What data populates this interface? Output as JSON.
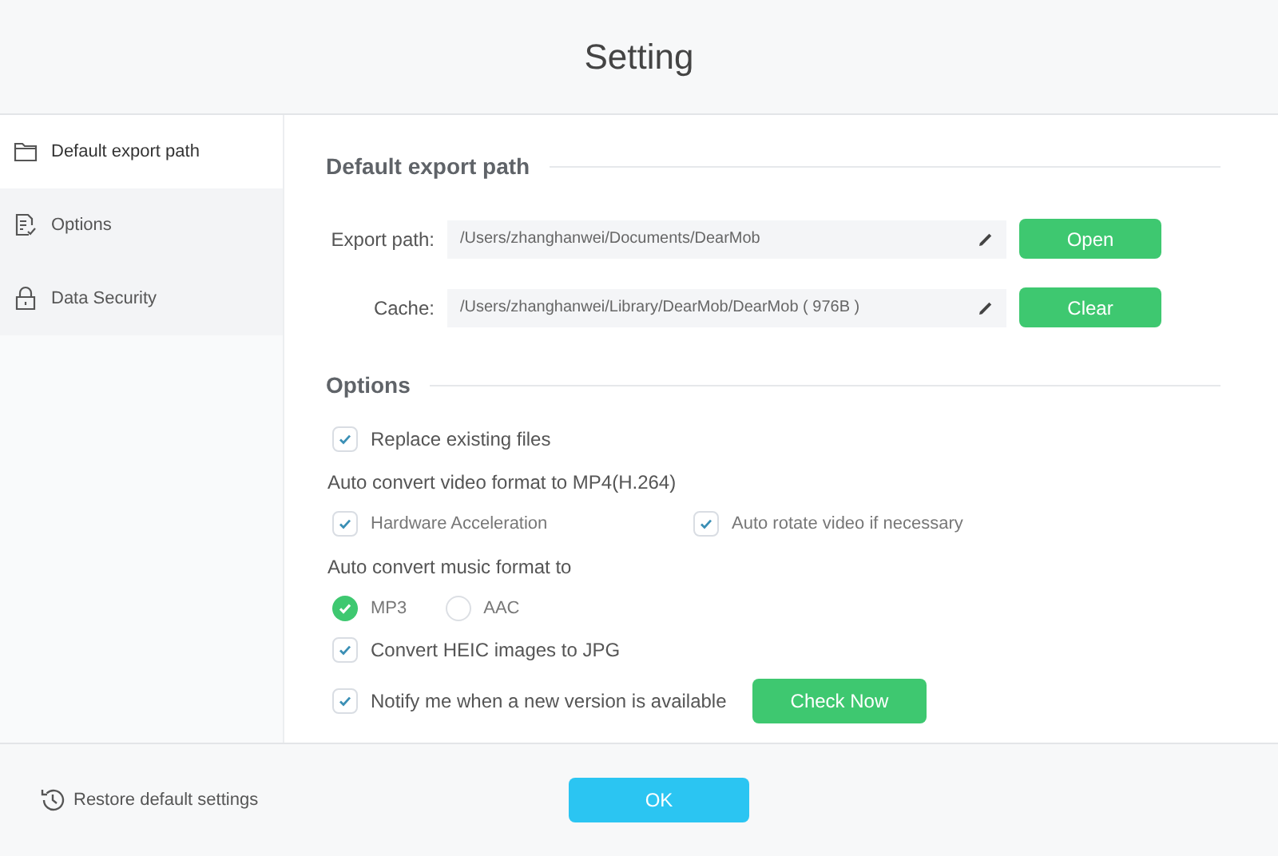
{
  "window": {
    "title": "Setting"
  },
  "sidebar": {
    "items": [
      {
        "label": "Default export path",
        "selected": true
      },
      {
        "label": "Options",
        "selected": false
      },
      {
        "label": "Data Security",
        "selected": false
      }
    ]
  },
  "export_section": {
    "title": "Default export path",
    "fields": [
      {
        "label": "Export path:",
        "value": "/Users/zhanghanwei/Documents/DearMob",
        "button": "Open"
      },
      {
        "label": "Cache:",
        "value": "/Users/zhanghanwei/Library/DearMob/DearMob ( 976B )",
        "button": "Clear"
      }
    ]
  },
  "options_section": {
    "title": "Options",
    "items": [
      {
        "kind": "checkbox",
        "label": "Replace existing files",
        "checked": true
      },
      {
        "kind": "heading",
        "label": "Auto convert video format to MP4(H.264)"
      },
      {
        "kind": "checkbox-pair",
        "options": [
          {
            "label": "Hardware Acceleration",
            "checked": true
          },
          {
            "label": "Auto rotate video if necessary",
            "checked": true
          }
        ]
      },
      {
        "kind": "heading",
        "label": "Auto convert music format to"
      },
      {
        "kind": "radio-group",
        "options": [
          {
            "label": "MP3",
            "selected": true
          },
          {
            "label": "AAC",
            "selected": false
          }
        ]
      },
      {
        "kind": "checkbox",
        "label": "Convert HEIC images to JPG",
        "checked": true
      },
      {
        "kind": "checkbox-button",
        "label": "Notify me when a new version is available",
        "checked": true,
        "button": "Check Now"
      }
    ]
  },
  "footer": {
    "restore": "Restore default settings",
    "ok": "OK"
  }
}
